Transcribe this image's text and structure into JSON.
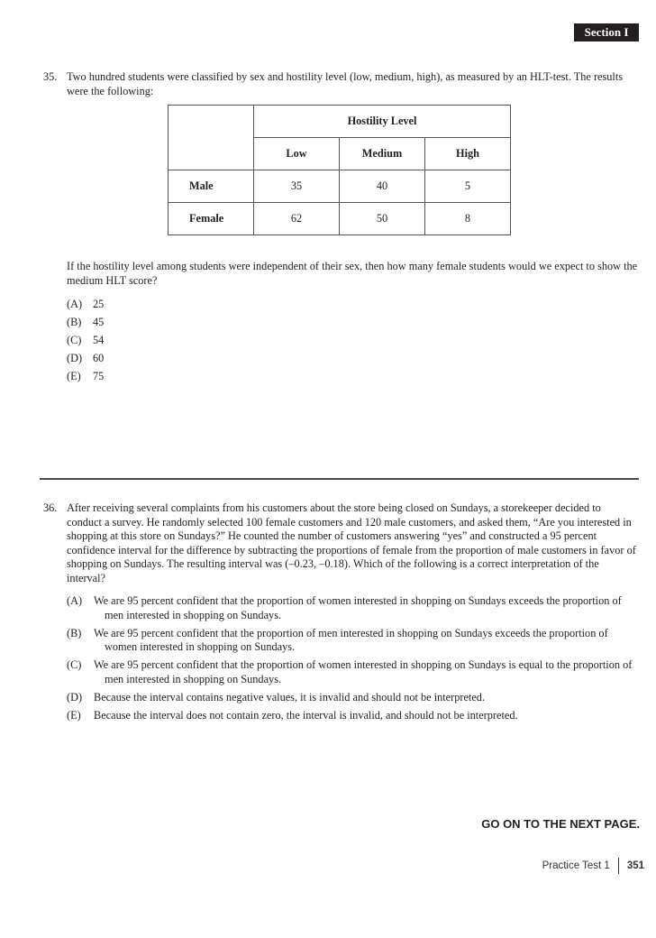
{
  "header": {
    "section_label": "Section I"
  },
  "question_35": {
    "number": "35.",
    "stem": "Two hundred students were classified by sex and hostility level (low, medium, high), as measured by an HLT-test. The results were the following:",
    "table": {
      "group_header": "Hostility Level",
      "columns": [
        "Low",
        "Medium",
        "High"
      ],
      "rows": [
        {
          "label": "Male",
          "values": [
            "35",
            "40",
            "5"
          ]
        },
        {
          "label": "Female",
          "values": [
            "62",
            "50",
            "8"
          ]
        }
      ]
    },
    "followup": "If the hostility level among students were independent of their sex, then how many female students would we expect to show the medium HLT score?",
    "choices": [
      {
        "label": "(A)",
        "text": "25"
      },
      {
        "label": "(B)",
        "text": "45"
      },
      {
        "label": "(C)",
        "text": "54"
      },
      {
        "label": "(D)",
        "text": "60"
      },
      {
        "label": "(E)",
        "text": "75"
      }
    ]
  },
  "question_36": {
    "number": "36.",
    "stem": "After receiving several complaints from his customers about the store being closed on Sundays, a storekeeper decided to conduct a survey. He randomly selected 100 female customers and 120 male customers, and asked them, “Are you interested in shopping at this store on Sundays?” He counted the number of customers answering “yes” and constructed a 95 percent confidence interval for the difference by subtracting the proportions of female from the proportion of male customers in favor of shopping on Sundays. The resulting interval was (–0.23, –0.18). Which of the following is a correct interpretation of the interval?",
    "choices": [
      {
        "label": "(A)",
        "text": "We are 95 percent confident that the proportion of women interested in shopping on Sundays exceeds the proportion of men interested in shopping on Sundays."
      },
      {
        "label": "(B)",
        "text": "We are 95 percent confident that the proportion of men interested in shopping on Sundays exceeds the proportion of women interested in shopping on Sundays."
      },
      {
        "label": "(C)",
        "text": "We are 95 percent confident that the proportion of women interested in shopping on Sundays is equal to the proportion of men interested in shopping on Sundays."
      },
      {
        "label": "(D)",
        "text": "Because the interval contains negative values, it is invalid and should not be interpreted."
      },
      {
        "label": "(E)",
        "text": "Because the interval does not contain zero, the interval is invalid, and should not be interpreted."
      }
    ]
  },
  "footer": {
    "go_on": "GO ON TO THE NEXT PAGE.",
    "book_label": "Practice Test 1",
    "page_number": "351"
  }
}
